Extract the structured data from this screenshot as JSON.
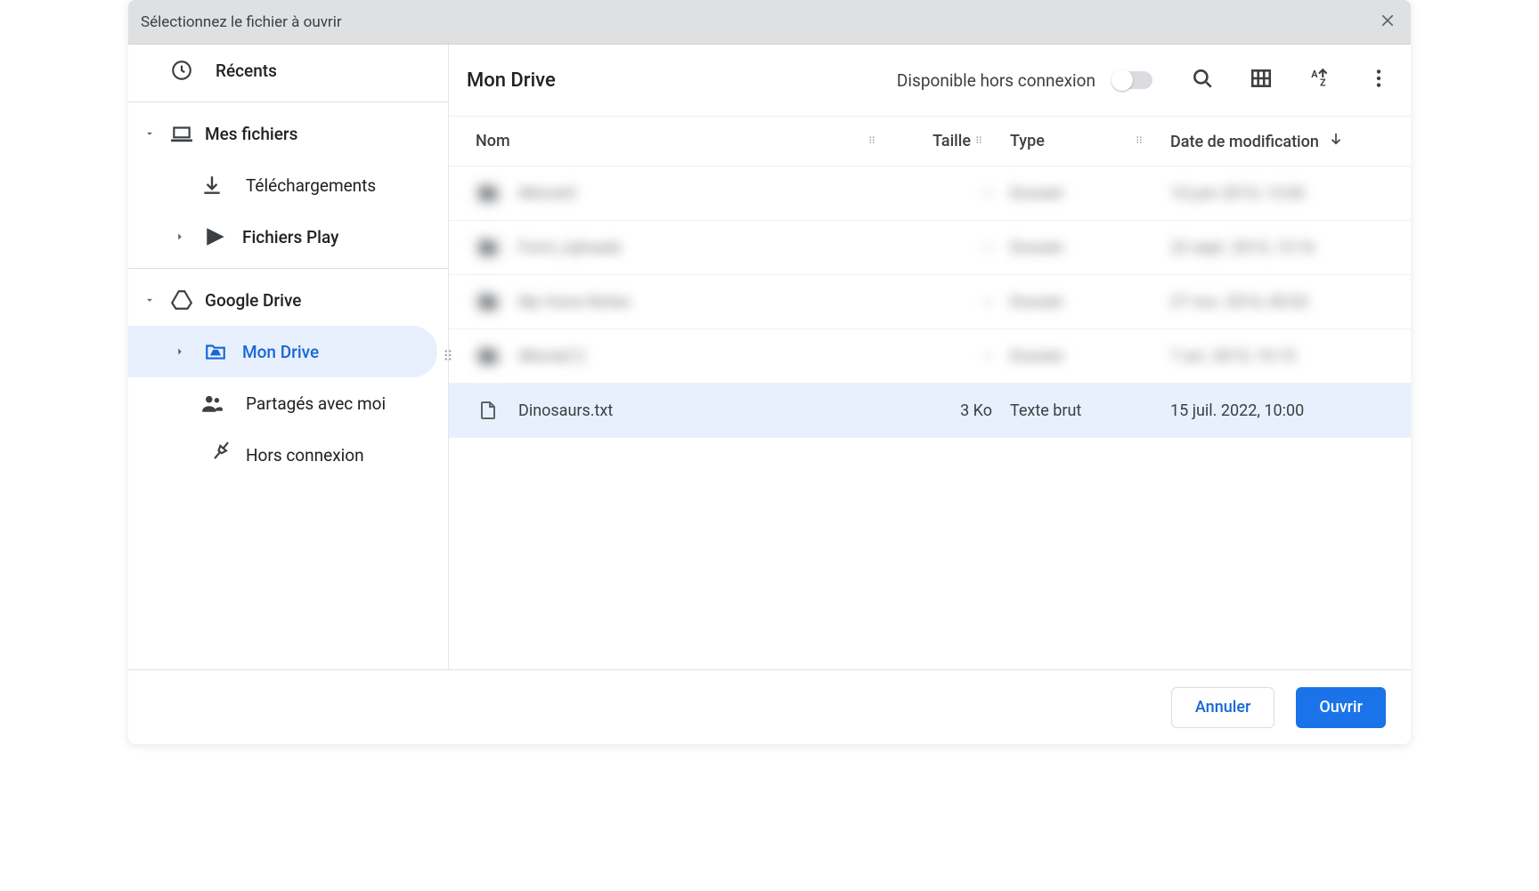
{
  "titlebar": {
    "title": "Sélectionnez le fichier à ouvrir"
  },
  "sidebar": {
    "recents": "Récents",
    "my_files": "Mes fichiers",
    "downloads": "Téléchargements",
    "play_files": "Fichiers Play",
    "google_drive": "Google Drive",
    "my_drive": "Mon Drive",
    "shared_with_me": "Partagés avec moi",
    "offline": "Hors connexion"
  },
  "main": {
    "location_title": "Mon Drive",
    "offline_label": "Disponible hors connexion",
    "columns": {
      "name": "Nom",
      "size": "Taille",
      "type": "Type",
      "modified": "Date de modification"
    },
    "blurred_rows": [
      {
        "name": "iMovieO",
        "size": "--",
        "type": "Dossier",
        "modified": "10 juin 2015, 13:00"
      },
      {
        "name": "Form_Uploads",
        "size": "--",
        "type": "Dossier",
        "modified": "23 sept. 2015, 13:16"
      },
      {
        "name": "My Voice Notes",
        "size": "--",
        "type": "Dossier",
        "modified": "27 nov. 2016, 00:02"
      },
      {
        "name": "iMovie(1)",
        "size": "--",
        "type": "Dossier",
        "modified": "7 avr. 2015, 10:15"
      }
    ],
    "selected_row": {
      "name": "Dinosaurs.txt",
      "size": "3 Ko",
      "type": "Texte brut",
      "modified": "15 juil. 2022, 10:00"
    }
  },
  "footer": {
    "cancel": "Annuler",
    "open": "Ouvrir"
  }
}
